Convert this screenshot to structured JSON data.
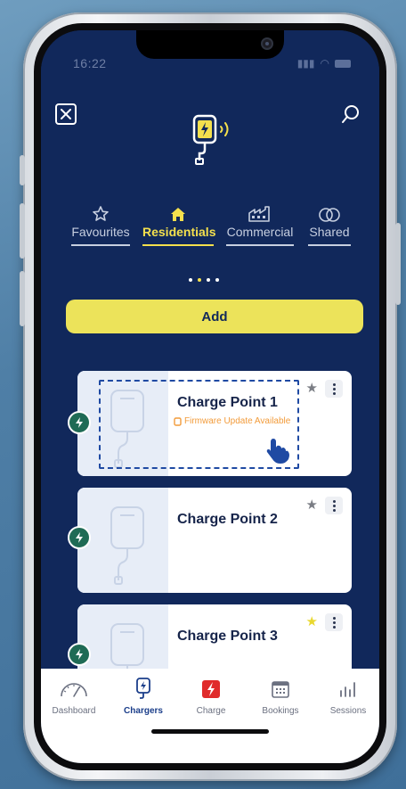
{
  "status_bar": {
    "time": "16:22"
  },
  "header": {
    "close_icon": "close-icon",
    "search_icon": "search-icon",
    "logo_icon": "charger-wireless-icon"
  },
  "tabs": [
    {
      "label": "Favourites",
      "icon": "star-outline-icon"
    },
    {
      "label": "Residentials",
      "icon": "house-icon",
      "active": true
    },
    {
      "label": "Commercial",
      "icon": "factory-icon"
    },
    {
      "label": "Shared",
      "icon": "linked-circles-icon"
    }
  ],
  "pager": {
    "count": 4,
    "active_index": 1
  },
  "add_label": "Add",
  "chargers": [
    {
      "name": "Charge Point 1",
      "notice": "Firmware Update Available",
      "favourite": false
    },
    {
      "name": "Charge Point 2",
      "notice": "",
      "favourite": false
    },
    {
      "name": "Charge Point 3",
      "notice": "",
      "favourite": true
    }
  ],
  "bottom_nav": [
    {
      "label": "Dashboard",
      "icon": "gauge-icon"
    },
    {
      "label": "Chargers",
      "icon": "charger-icon",
      "active": true
    },
    {
      "label": "Charge",
      "icon": "lightning-icon"
    },
    {
      "label": "Bookings",
      "icon": "calendar-icon"
    },
    {
      "label": "Sessions",
      "icon": "bar-chart-icon"
    }
  ],
  "colors": {
    "primary": "#12295a",
    "accent": "#f4e04d",
    "badge": "#1f6b55",
    "notice": "#f29b3a",
    "nav_active": "#1b3e8a"
  }
}
